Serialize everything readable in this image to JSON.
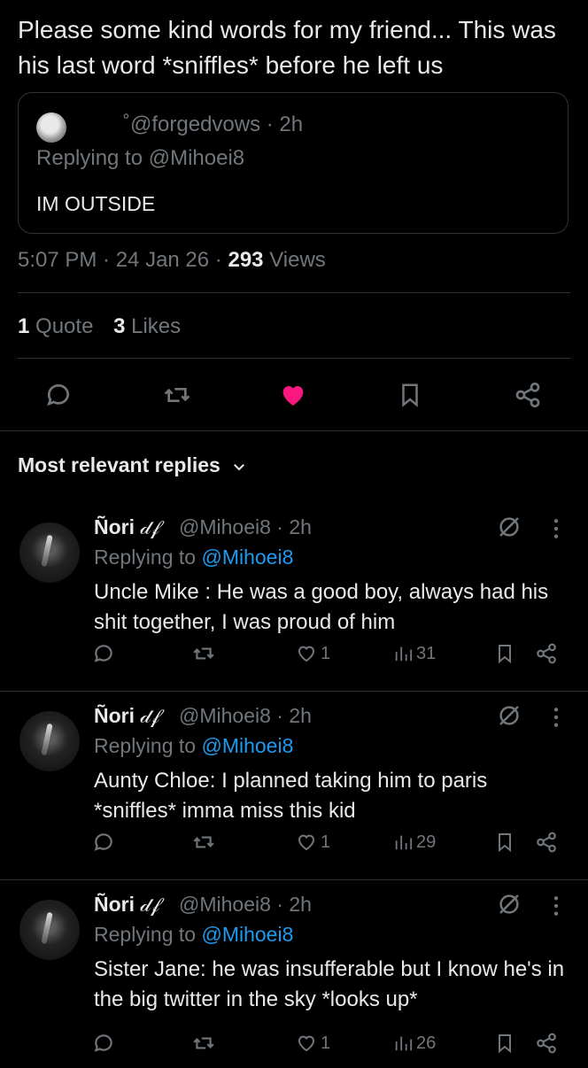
{
  "main_tweet": {
    "text": "Please some kind words for my friend... This was his last word *sniffles* before he left us"
  },
  "quoted_tweet": {
    "handle": "@forgedvows · 2h",
    "handle_prefix": "˚",
    "replying_to": "Replying to @Mihoei8",
    "text": "IM OUTSIDE"
  },
  "meta": {
    "time": "5:07 PM · 24 Jan 26 ·",
    "views_count": "293",
    "views_label": "Views"
  },
  "stats": {
    "quotes_count": "1",
    "quotes_label": "Quote",
    "likes_count": "3",
    "likes_label": "Likes"
  },
  "actions": [
    "reply-icon",
    "retweet-icon",
    "heart-filled-icon",
    "bookmark-icon",
    "share-icon"
  ],
  "colors": {
    "accent": "#1d9bf0",
    "like": "#f91880",
    "muted": "#71767b",
    "text": "#e7e9ea",
    "divider": "#2f3336"
  },
  "replies_section": {
    "title": "Most relevant replies"
  },
  "replies": [
    {
      "name": "Ñori",
      "name_glyph": "𝒹𝒻",
      "handle": "@Mihoei8 · 2h",
      "replying_prefix": "Replying to",
      "replying_user": "@Mihoei8",
      "text": "Uncle Mike : He was a good boy, always had his shit together, I was proud of him",
      "likes": "1",
      "views": "31"
    },
    {
      "name": "Ñori",
      "name_glyph": "𝒹𝒻",
      "handle": "@Mihoei8 · 2h",
      "replying_prefix": "Replying to",
      "replying_user": "@Mihoei8",
      "text": "Aunty Chloe: I planned taking him to paris *sniffles* imma miss this kid",
      "likes": "1",
      "views": "29"
    },
    {
      "name": "Ñori",
      "name_glyph": "𝒹𝒻",
      "handle": "@Mihoei8 · 2h",
      "replying_prefix": "Replying to",
      "replying_user": "@Mihoei8",
      "text": "Sister Jane: he was insufferable but I know he's in the big twitter in the sky *looks up*",
      "likes": "1",
      "views": "26"
    }
  ]
}
